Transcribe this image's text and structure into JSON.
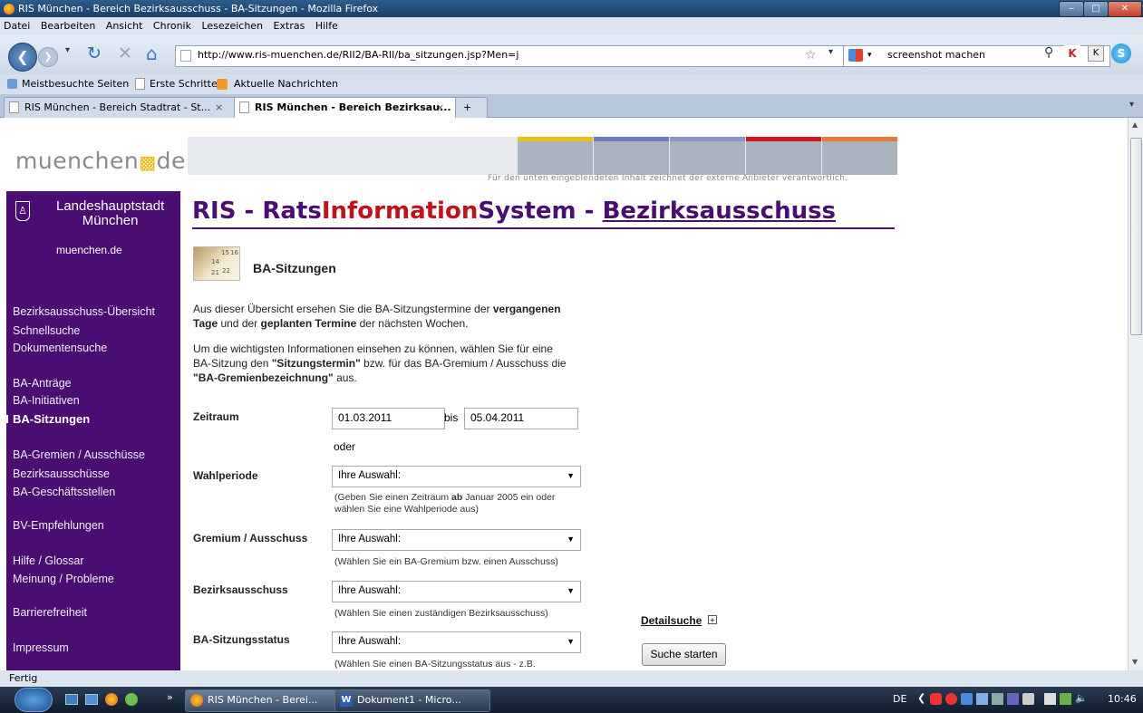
{
  "window": {
    "title": "RIS München - Bereich Bezirksausschuss - BA-Sitzungen - Mozilla Firefox",
    "min_label": "‒",
    "max_label": "□",
    "close_label": "✕"
  },
  "menu": [
    "Datei",
    "Bearbeiten",
    "Ansicht",
    "Chronik",
    "Lesezeichen",
    "Extras",
    "Hilfe"
  ],
  "navbar": {
    "url": "http://www.ris-muenchen.de/RII2/BA-RII/ba_sitzungen.jsp?Men=j",
    "search": "screenshot machen"
  },
  "bookmarks": [
    "Meistbesuchte Seiten",
    "Erste Schritte",
    "Aktuelle Nachrichten"
  ],
  "tabs": [
    {
      "label": "RIS München - Bereich Stadtrat - St...",
      "close": "×"
    },
    {
      "label": "RIS München - Bereich Bezirksau...",
      "close": "×"
    },
    {
      "label": "+"
    }
  ],
  "header": {
    "logo_left": "muenchen",
    "logo_right": "de",
    "disclaimer": "Für den unten eingeblendeten Inhalt zeichnet der externe Anbieter verantwortlich.",
    "banner_colors": [
      "#e8c21a",
      "#6f7bb8",
      "#8c95c7",
      "#d0121a",
      "#e9783a"
    ]
  },
  "sidebar": {
    "city_line1": "Landeshauptstadt",
    "city_line2": "München",
    "link": "muenchen.de",
    "items": [
      "Bezirksausschuss-Übersicht",
      "Schnellsuche",
      "Dokumentensuche",
      "BA-Anträge",
      "BA-Initiativen",
      "BA-Sitzungen",
      "BA-Gremien / Ausschüsse",
      "Bezirksausschüsse",
      "BA-Geschäftsstellen",
      "BV-Empfehlungen",
      "Hilfe / Glossar",
      "Meinung / Probleme",
      "Barrierefreiheit",
      "Impressum"
    ],
    "active_index": 5
  },
  "main": {
    "title_ris": "RIS",
    "title_sep": " - ",
    "title_rats": "Rats",
    "title_information": "Information",
    "title_system": "System",
    "title_ba": "Bezirksausschuss",
    "section": "BA-Sitzungen",
    "calendar_nums": [
      "14",
      "15",
      "16",
      "21",
      "22"
    ],
    "intro1_a": "Aus dieser Übersicht ersehen Sie die BA-Sitzungstermine der ",
    "intro1_b": "vergangenen",
    "intro1_c": "Tage",
    "intro1_d": " und der ",
    "intro1_e": "geplanten Termine",
    "intro1_f": " der nächsten Wochen.",
    "intro2_a": "Um die wichtigsten Informationen einsehen zu können, wählen Sie für eine",
    "intro2_b": "BA-Sitzung den ",
    "intro2_c": "\"Sitzungstermin\"",
    "intro2_d": " bzw. für das BA-Gremium / Ausschuss die",
    "intro2_e": "\"BA-Gremienbezeichnung\"",
    "intro2_f": " aus."
  },
  "form": {
    "zeitraum_label": "Zeitraum",
    "date_from": "01.03.2011",
    "bis": "bis",
    "date_to": "05.04.2011",
    "oder": "oder",
    "wahlperiode_label": "Wahlperiode",
    "wahlperiode_value": "Ihre Auswahl:",
    "wahlperiode_hint1_a": "(Geben Sie einen Zeitraum ",
    "wahlperiode_hint1_b": "ab",
    "wahlperiode_hint1_c": " Januar 2005 ein oder",
    "wahlperiode_hint2": "wählen Sie eine Wahlperiode aus)",
    "gremium_label": "Gremium / Ausschuss",
    "gremium_value": "Ihre Auswahl:",
    "gremium_hint": "(Wählen Sie ein BA-Gremium bzw. einen Ausschuss)",
    "ba_label": "Bezirksausschuss",
    "ba_value": "Ihre Auswahl:",
    "ba_hint": "(Wählen Sie einen zuständigen Bezirksausschuss)",
    "status_label": "BA-Sitzungsstatus",
    "status_value": "Ihre Auswahl:",
    "status_hint": "(Wählen Sie einen BA-Sitzungsstatus aus - z.B.",
    "detailsuche": "Detailsuche",
    "submit": "Suche starten"
  },
  "status": "Fertig",
  "taskbar": {
    "items": [
      "RIS München - Berei...",
      "Dokument1 - Micro..."
    ],
    "lang": "DE",
    "time": "10:46",
    "chevron": "»"
  }
}
